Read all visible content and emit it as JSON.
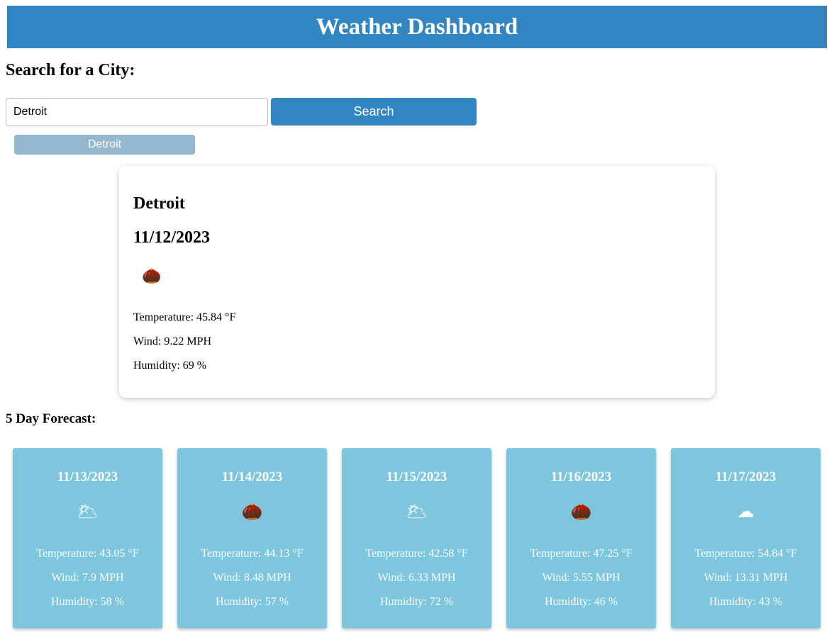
{
  "header": {
    "title": "Weather Dashboard"
  },
  "search": {
    "heading": "Search for a City:",
    "input_value": "Detroit",
    "button_label": "Search"
  },
  "history": [
    {
      "label": "Detroit"
    }
  ],
  "current": {
    "city": "Detroit",
    "date": "11/12/2023",
    "icon": "🌰",
    "icon_name": "scattered-clouds-icon",
    "temperature": "Temperature: 45.84 °F",
    "wind": "Wind: 9.22 MPH",
    "humidity": "Humidity: 69 %"
  },
  "forecast": {
    "heading": "5 Day Forecast:",
    "days": [
      {
        "date": "11/13/2023",
        "icon": "🌥",
        "icon_name": "few-clouds-icon",
        "temperature": "Temperature: 43.05 °F",
        "wind": "Wind: 7.9 MPH",
        "humidity": "Humidity: 58 %"
      },
      {
        "date": "11/14/2023",
        "icon": "🌰",
        "icon_name": "scattered-clouds-icon",
        "temperature": "Temperature: 44.13 °F",
        "wind": "Wind: 8.48 MPH",
        "humidity": "Humidity: 57 %"
      },
      {
        "date": "11/15/2023",
        "icon": "🌥",
        "icon_name": "few-clouds-icon",
        "temperature": "Temperature: 42.58 °F",
        "wind": "Wind: 6.33 MPH",
        "humidity": "Humidity: 72 %"
      },
      {
        "date": "11/16/2023",
        "icon": "🌰",
        "icon_name": "scattered-clouds-icon",
        "temperature": "Temperature: 47.25 °F",
        "wind": "Wind: 5.55 MPH",
        "humidity": "Humidity: 46 %"
      },
      {
        "date": "11/17/2023",
        "icon": "☁",
        "icon_name": "broken-clouds-icon",
        "temperature": "Temperature: 54.84 °F",
        "wind": "Wind: 13.31 MPH",
        "humidity": "Humidity: 43 %"
      }
    ]
  },
  "colors": {
    "header": "#3186c2",
    "search_button": "#3186c2",
    "history_button": "#93b7cd",
    "forecast_card": "#7dc6dd"
  }
}
